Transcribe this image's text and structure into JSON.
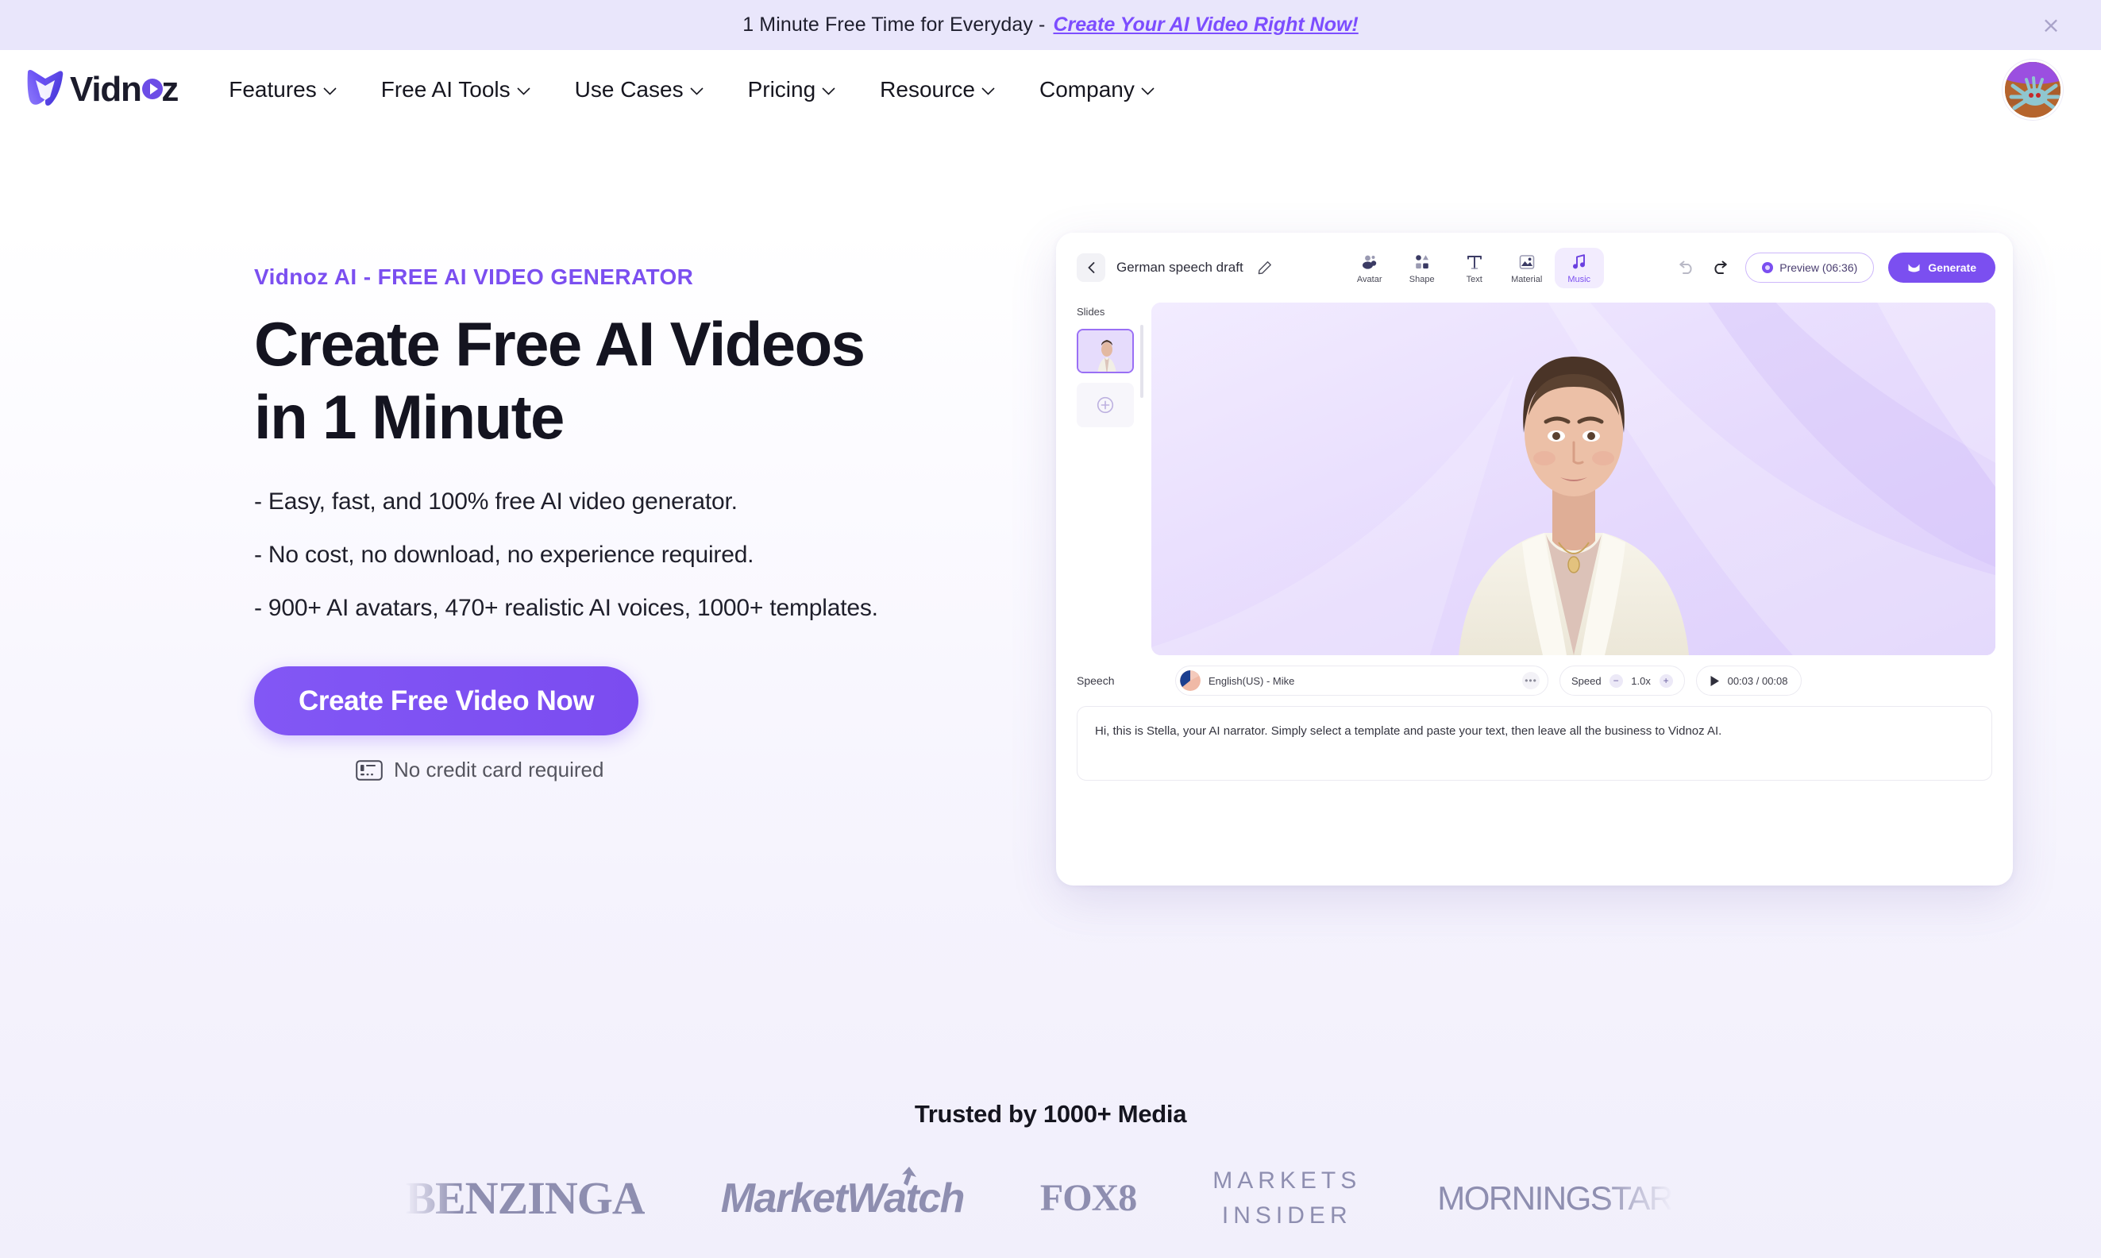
{
  "banner": {
    "text": "1 Minute Free Time for Everyday -",
    "link": "Create Your AI Video Right Now!",
    "close": "×"
  },
  "header": {
    "logo_text": "Vidn",
    "logo_o": "o",
    "logo_text_end": "z",
    "nav": [
      {
        "label": "Features"
      },
      {
        "label": "Free AI Tools"
      },
      {
        "label": "Use Cases"
      },
      {
        "label": "Pricing"
      },
      {
        "label": "Resource"
      },
      {
        "label": "Company"
      }
    ]
  },
  "hero": {
    "eyebrow": "Vidnoz AI - FREE AI VIDEO GENERATOR",
    "title_line1": "Create Free AI Videos",
    "title_line2": "in 1 Minute",
    "bullets": [
      "- Easy, fast, and 100% free AI video generator.",
      "- No cost, no download, no experience required.",
      "- 900+ AI avatars, 470+ realistic AI voices, 1000+ templates."
    ],
    "cta_label": "Create Free Video Now",
    "no_credit_label": "No credit card required"
  },
  "mockup": {
    "project_title": "German speech draft",
    "tools": [
      {
        "label": "Avatar",
        "active": false
      },
      {
        "label": "Shape",
        "active": false
      },
      {
        "label": "Text",
        "active": false
      },
      {
        "label": "Material",
        "active": false
      },
      {
        "label": "Music",
        "active": true
      }
    ],
    "preview_label": "Preview (06:36)",
    "generate_label": "Generate",
    "slides_label": "Slides",
    "speech_label": "Speech",
    "voice_name": "English(US) - Mike",
    "voice_more": "•••",
    "speed_label": "Speed",
    "speed_value": "1.0x",
    "speed_minus": "−",
    "speed_plus": "+",
    "time_value": "00:03 / 00:08",
    "speech_text": "Hi, this is Stella, your AI narrator. Simply select a template and paste your text, then leave all the business to Vidnoz AI."
  },
  "trusted": {
    "title": "Trusted by 1000+ Media",
    "logos": [
      {
        "name": "BENZINGA"
      },
      {
        "name": "MarketWatch"
      },
      {
        "name": "FOX8"
      },
      {
        "name": "MARKETS",
        "name2": "INSIDER"
      },
      {
        "name": "MORNINGSTAR"
      }
    ]
  },
  "colors": {
    "accent": "#7b4ff0",
    "banner_bg": "#e9e6fb",
    "page_bg": "#f1effb",
    "text": "#141420",
    "muted": "#8e8eb0"
  }
}
